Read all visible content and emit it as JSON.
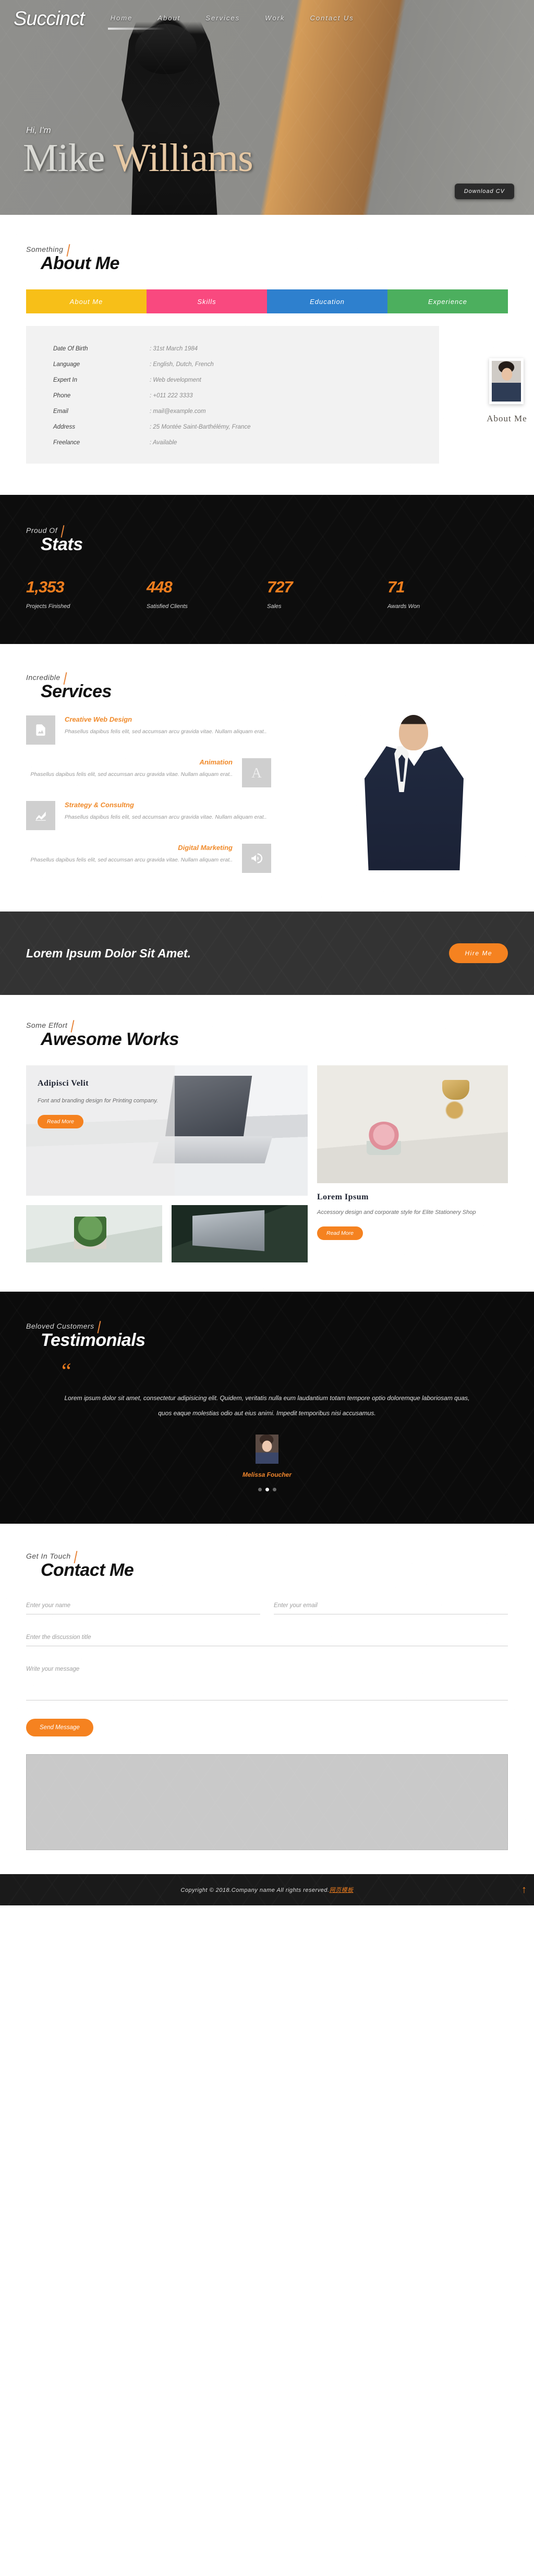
{
  "site": {
    "logo": "Succinct"
  },
  "nav": {
    "items": [
      {
        "label": "Home",
        "active": true
      },
      {
        "label": "About",
        "active": false
      },
      {
        "label": "Services",
        "active": false
      },
      {
        "label": "Work",
        "active": false
      },
      {
        "label": "Contact Us",
        "active": false
      }
    ]
  },
  "hero": {
    "greeting": "Hi, I'm",
    "first_name": "Mike",
    "last_name": "Williams",
    "cta_label": "Download CV",
    "accent_color": "#e7c9a4"
  },
  "about": {
    "eyebrow": "Something",
    "title": "About Me",
    "tabs": [
      {
        "label": "About Me",
        "color": "#f7bf18"
      },
      {
        "label": "Skills",
        "color": "#f9497f"
      },
      {
        "label": "Education",
        "color": "#2e80ce"
      },
      {
        "label": "Experience",
        "color": "#4caf5e"
      }
    ],
    "details": [
      {
        "key": "Date Of Birth",
        "value": ": 31st March 1984"
      },
      {
        "key": "Language",
        "value": ": English, Dutch, French"
      },
      {
        "key": "Expert In",
        "value": ": Web development"
      },
      {
        "key": "Phone",
        "value": ": +011 222 3333"
      },
      {
        "key": "Email",
        "value": ": mail@example.com"
      },
      {
        "key": "Address",
        "value": ": 25 Montée Saint-Barthélémy, France"
      },
      {
        "key": "Freelance",
        "value": ": Available"
      }
    ],
    "photo_caption": "About Me"
  },
  "stats": {
    "eyebrow": "Proud Of",
    "title": "Stats",
    "accent_color": "#f07e1e",
    "items": [
      {
        "number": "1,353",
        "label": "Projects Finished"
      },
      {
        "number": "448",
        "label": "Satisfied Clients"
      },
      {
        "number": "727",
        "label": "Sales"
      },
      {
        "number": "71",
        "label": "Awards Won"
      }
    ]
  },
  "services": {
    "eyebrow": "Incredible",
    "title": "Services",
    "items": [
      {
        "title": "Creative Web Design",
        "desc": "Phasellus dapibus felis elit, sed accumsan arcu gravida vitae. Nullam aliquam erat..",
        "icon": "image-icon",
        "align": "left"
      },
      {
        "title": "Animation",
        "desc": "Phasellus dapibus felis elit, sed accumsan arcu gravida vitae. Nullam aliquam erat..",
        "icon": "letter-a-icon",
        "align": "right"
      },
      {
        "title": "Strategy & Consultng",
        "desc": "Phasellus dapibus felis elit, sed accumsan arcu gravida vitae. Nullam aliquam erat..",
        "icon": "chart-up-icon",
        "align": "left"
      },
      {
        "title": "Digital Marketing",
        "desc": "Phasellus dapibus felis elit, sed accumsan arcu gravida vitae. Nullam aliquam erat..",
        "icon": "megaphone-icon",
        "align": "right"
      }
    ]
  },
  "cta": {
    "headline": "Lorem Ipsum Dolor Sit Amet.",
    "button": "Hire Me"
  },
  "works": {
    "eyebrow": "Some Effort",
    "title": "Awesome Works",
    "featured": {
      "title": "Adipisci Velit",
      "desc": "Font and branding design for Printing company.",
      "button": "Read More"
    },
    "side": {
      "title": "Lorem Ipsum",
      "desc": "Accessory design and corporate style for Elite Stationery Shop",
      "button": "Read More"
    }
  },
  "testimonials": {
    "eyebrow": "Beloved Customers",
    "title": "Testimonials",
    "quote_glyph": "“",
    "quote": "Lorem ipsum dolor sit amet, consectetur adipisicing elit. Quidem, veritatis nulla eum laudantium totam tempore optio doloremque laboriosam quas, quos eaque molestias odio aut eius animi. Impedit temporibus nisi accusamus.",
    "author": "Melissa Foucher",
    "dots": 3,
    "active_dot": 1
  },
  "contact": {
    "eyebrow": "Get In Touch",
    "title": "Contact Me",
    "fields": {
      "name_placeholder": "Enter your name",
      "email_placeholder": "Enter your email",
      "subject_placeholder": "Enter the discussion title",
      "message_placeholder": "Write your message"
    },
    "submit_label": "Send Message"
  },
  "footer": {
    "copyright": "Copyright © 2018.Company name All rights reserved.",
    "link": "网页模板",
    "to_top_icon": "↑"
  }
}
